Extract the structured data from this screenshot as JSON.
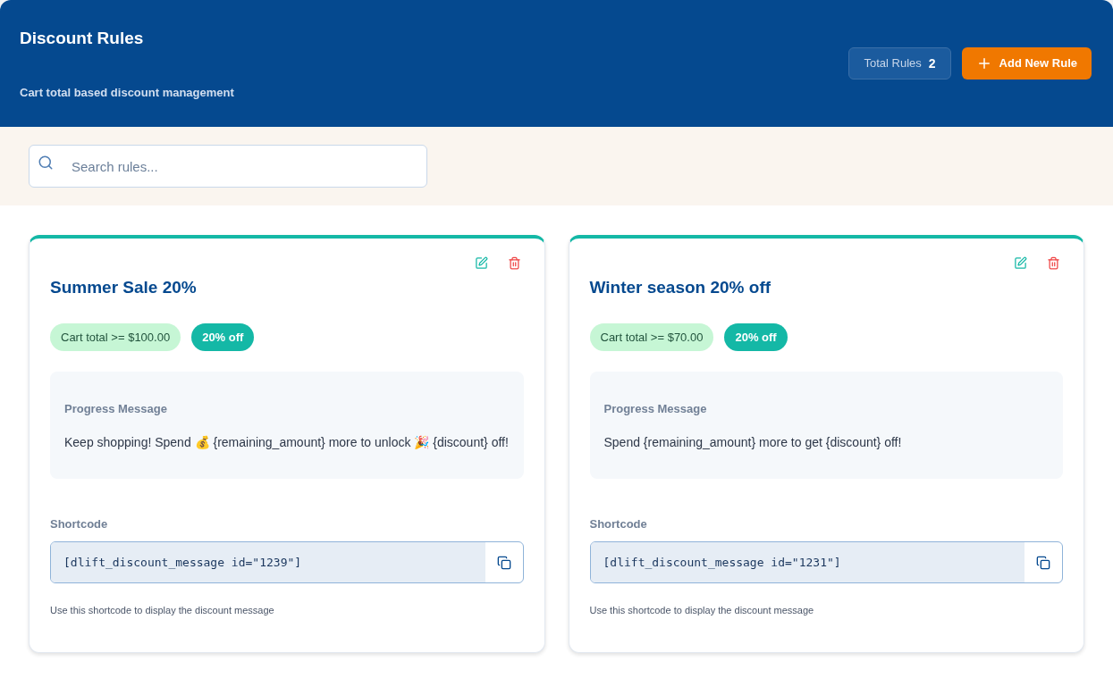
{
  "header": {
    "title": "Discount Rules",
    "subtitle": "Cart total based discount management",
    "total_label": "Total Rules",
    "total_count": "2",
    "add_button": "Add New Rule"
  },
  "search": {
    "placeholder": "Search rules..."
  },
  "rules": [
    {
      "title": "Summer Sale 20%",
      "condition": "Cart total >= $100.00",
      "discount": "20% off",
      "message_label": "Progress Message",
      "message": "Keep shopping! Spend 💰 {remaining_amount} more to unlock 🎉 {discount} off!",
      "shortcode_label": "Shortcode",
      "shortcode": "[dlift_discount_message id=\"1239\"]",
      "help": "Use this shortcode to display the discount message"
    },
    {
      "title": "Winter season 20% off",
      "condition": "Cart total >= $70.00",
      "discount": "20% off",
      "message_label": "Progress Message",
      "message": "Spend {remaining_amount} more to get {discount} off!",
      "shortcode_label": "Shortcode",
      "shortcode": "[dlift_discount_message id=\"1231\"]",
      "help": "Use this shortcode to display the discount message"
    }
  ]
}
